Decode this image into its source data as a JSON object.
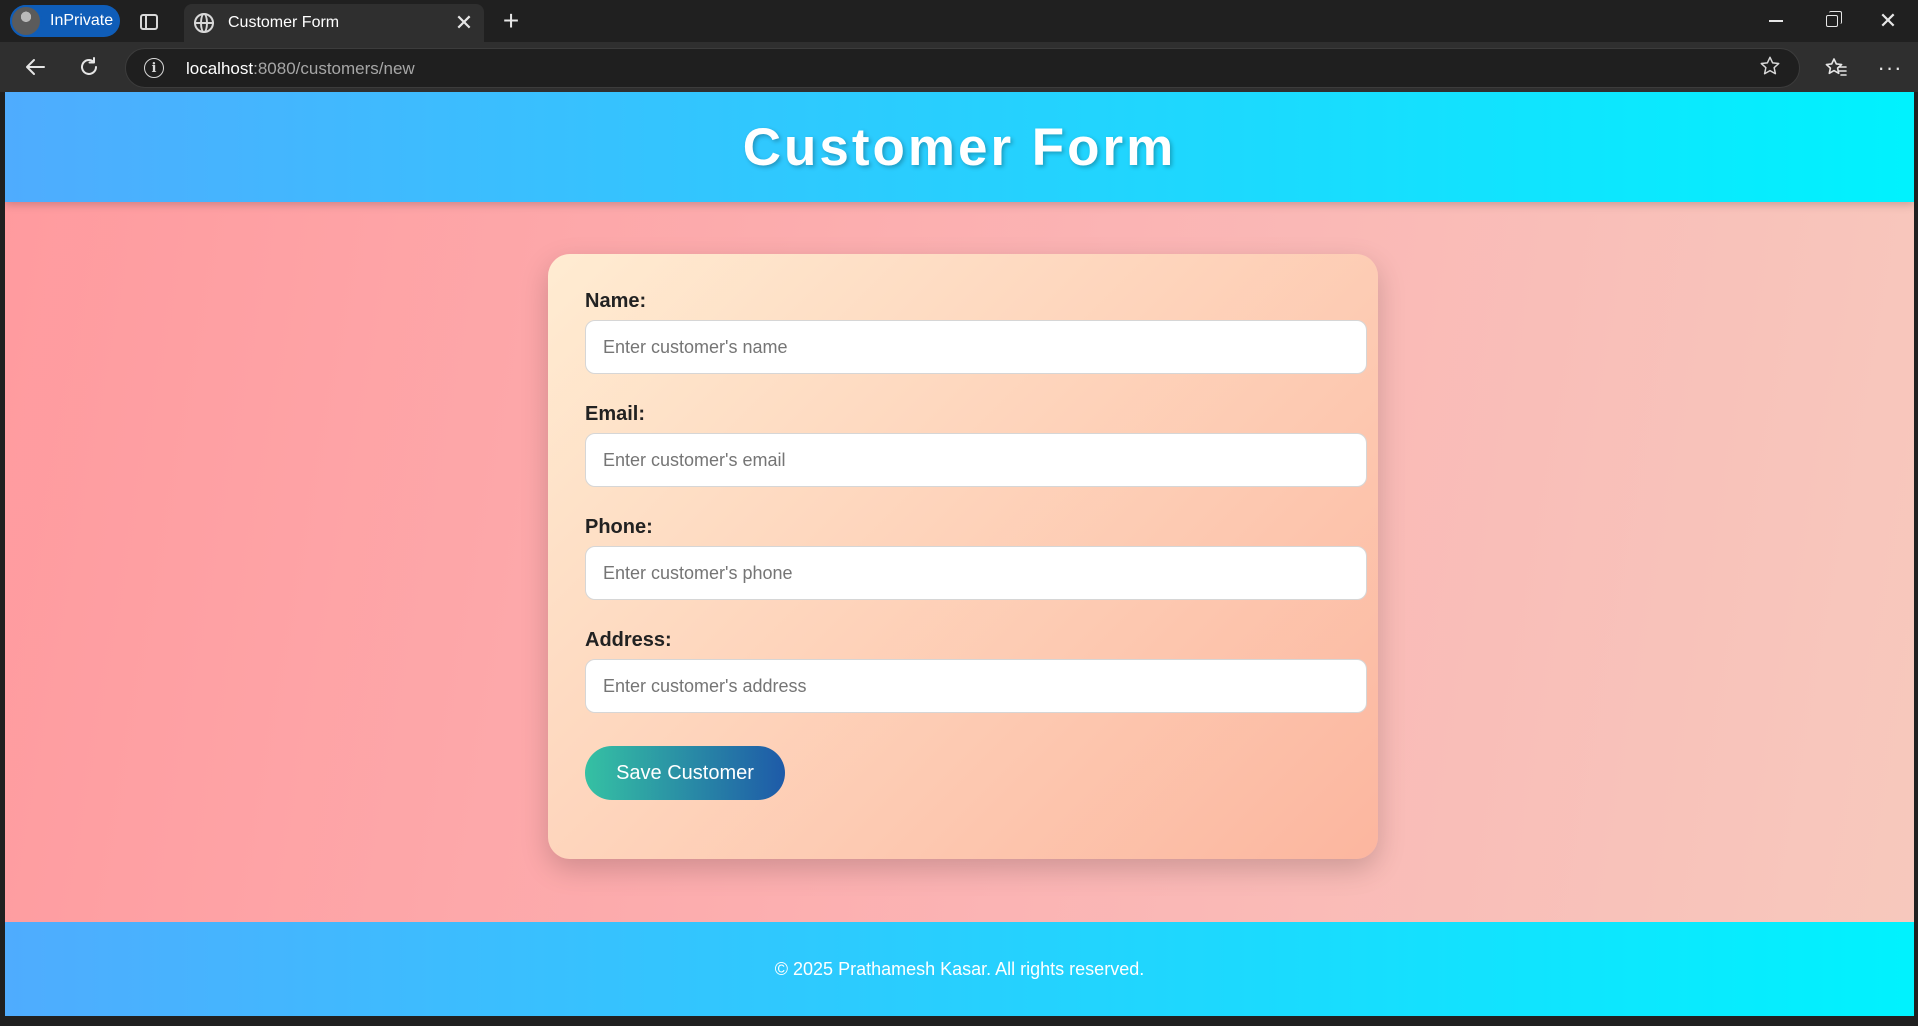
{
  "browser": {
    "profile_label": "InPrivate",
    "tab_title": "Customer Form",
    "new_tab_icon": "plus-icon",
    "url_host": "localhost",
    "url_path": ":8080/customers/new",
    "icons": {
      "back": "back-arrow-icon",
      "reload": "reload-icon",
      "site_info": "info-icon",
      "favorite": "star-icon",
      "favorites_list": "favorites-icon",
      "more": "more-icon"
    }
  },
  "header": {
    "title": "Customer Form"
  },
  "form": {
    "fields": [
      {
        "label": "Name:",
        "placeholder": "Enter customer's name",
        "value": ""
      },
      {
        "label": "Email:",
        "placeholder": "Enter customer's email",
        "value": ""
      },
      {
        "label": "Phone:",
        "placeholder": "Enter customer's phone",
        "value": ""
      },
      {
        "label": "Address:",
        "placeholder": "Enter customer's address",
        "value": ""
      }
    ],
    "submit_label": "Save Customer"
  },
  "footer": {
    "text": "© 2025 Prathamesh Kasar. All rights reserved."
  },
  "colors": {
    "header_gradient": [
      "#4facfe",
      "#00f2fe"
    ],
    "page_gradient": [
      "#ff9a9e",
      "#f7c9bd"
    ],
    "card_gradient": [
      "#ffecd2",
      "#fcb69f"
    ],
    "button_gradient": [
      "#35c1a3",
      "#1e5aa8"
    ]
  }
}
